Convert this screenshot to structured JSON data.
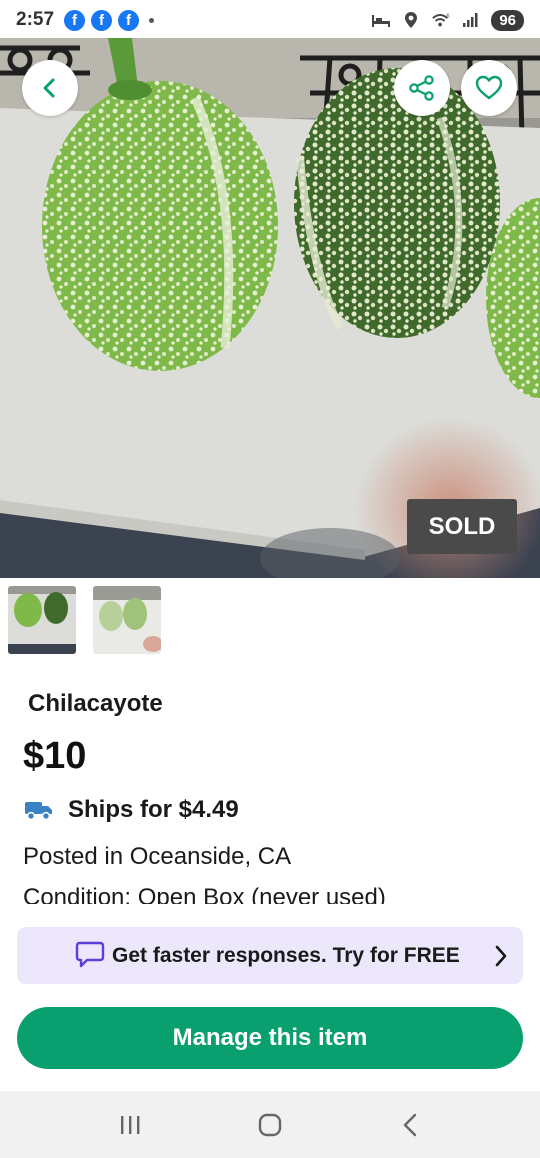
{
  "status_bar": {
    "time": "2:57",
    "notification_icons": [
      "facebook-icon",
      "facebook-icon",
      "facebook-icon"
    ],
    "fb_glyph": "f",
    "battery": "96",
    "indicator_icons": [
      "sleep-mode-icon",
      "location-icon",
      "wifi-6-icon",
      "signal-icon"
    ]
  },
  "hero": {
    "badge": "SOLD",
    "buttons": [
      "back-icon",
      "share-icon",
      "heart-icon"
    ]
  },
  "thumbnails": {
    "count": 2,
    "selected_index": 0
  },
  "listing": {
    "title": "Chilacayote",
    "price": "$10",
    "shipping": "Ships for $4.49",
    "posted": "Posted in Oceanside, CA",
    "condition": "Condition: Open Box (never used)"
  },
  "promo": {
    "text": "Get faster responses. Try for FREE"
  },
  "actions": {
    "manage_label": "Manage this item"
  },
  "colors": {
    "accent_green": "#0a9f6e",
    "promo_bg": "#ece7fb",
    "promo_icon": "#5b3fd8",
    "truck_blue": "#3b82c4",
    "sold_badge": "#4a4a4a"
  },
  "navigation": [
    "recent-apps-icon",
    "home-icon",
    "back-nav-icon"
  ]
}
